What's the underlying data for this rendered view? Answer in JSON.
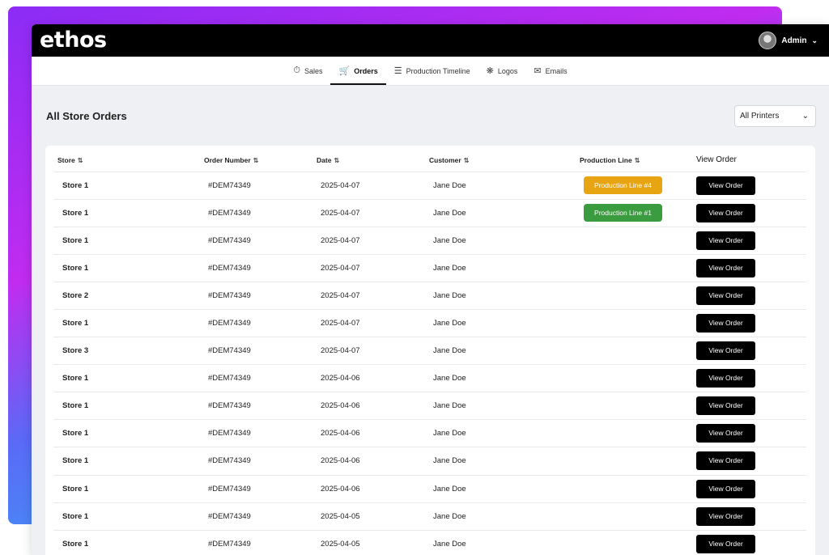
{
  "brand": {
    "logo": "ethos"
  },
  "user": {
    "name": "Admin",
    "chevron": "⌄"
  },
  "nav": [
    {
      "label": "Sales",
      "icon": "sales-icon",
      "glyph": "⏱",
      "active": false
    },
    {
      "label": "Orders",
      "icon": "cart-icon",
      "glyph": "🛒",
      "active": true
    },
    {
      "label": "Production Timeline",
      "icon": "timeline-icon",
      "glyph": "☰",
      "active": false
    },
    {
      "label": "Logos",
      "icon": "logos-icon",
      "glyph": "❋",
      "active": false
    },
    {
      "label": "Emails",
      "icon": "mail-icon",
      "glyph": "✉",
      "active": false
    }
  ],
  "page": {
    "title": "All Store Orders"
  },
  "filter": {
    "value": "All Printers"
  },
  "table": {
    "headers": {
      "store": "Store",
      "order": "Order Number",
      "date": "Date",
      "customer": "Customer",
      "line": "Production Line",
      "view": "View Order"
    },
    "sort_glyph": "⇅",
    "view_label": "View Order",
    "rows": [
      {
        "store": "Store 1",
        "order": "#DEM74349",
        "date": "2025-04-07",
        "customer": "Jane Doe",
        "line": "Production Line #4",
        "line_color": "yellow"
      },
      {
        "store": "Store 1",
        "order": "#DEM74349",
        "date": "2025-04-07",
        "customer": "Jane Doe",
        "line": "Production Line #1",
        "line_color": "green"
      },
      {
        "store": "Store 1",
        "order": "#DEM74349",
        "date": "2025-04-07",
        "customer": "Jane Doe",
        "line": "",
        "line_color": ""
      },
      {
        "store": "Store 1",
        "order": "#DEM74349",
        "date": "2025-04-07",
        "customer": "Jane Doe",
        "line": "",
        "line_color": ""
      },
      {
        "store": "Store 2",
        "order": "#DEM74349",
        "date": "2025-04-07",
        "customer": "Jane Doe",
        "line": "",
        "line_color": ""
      },
      {
        "store": "Store 1",
        "order": "#DEM74349",
        "date": "2025-04-07",
        "customer": "Jane Doe",
        "line": "",
        "line_color": ""
      },
      {
        "store": "Store 3",
        "order": "#DEM74349",
        "date": "2025-04-07",
        "customer": "Jane Doe",
        "line": "",
        "line_color": ""
      },
      {
        "store": "Store 1",
        "order": "#DEM74349",
        "date": "2025-04-06",
        "customer": "Jane Doe",
        "line": "",
        "line_color": ""
      },
      {
        "store": "Store 1",
        "order": "#DEM74349",
        "date": "2025-04-06",
        "customer": "Jane Doe",
        "line": "",
        "line_color": ""
      },
      {
        "store": "Store 1",
        "order": "#DEM74349",
        "date": "2025-04-06",
        "customer": "Jane Doe",
        "line": "",
        "line_color": ""
      },
      {
        "store": "Store 1",
        "order": "#DEM74349",
        "date": "2025-04-06",
        "customer": "Jane Doe",
        "line": "",
        "line_color": ""
      },
      {
        "store": "Store 1",
        "order": "#DEM74349",
        "date": "2025-04-06",
        "customer": "Jane Doe",
        "line": "",
        "line_color": ""
      },
      {
        "store": "Store 1",
        "order": "#DEM74349",
        "date": "2025-04-05",
        "customer": "Jane Doe",
        "line": "",
        "line_color": ""
      },
      {
        "store": "Store 1",
        "order": "#DEM74349",
        "date": "2025-04-05",
        "customer": "Jane Doe",
        "line": "",
        "line_color": ""
      }
    ]
  }
}
